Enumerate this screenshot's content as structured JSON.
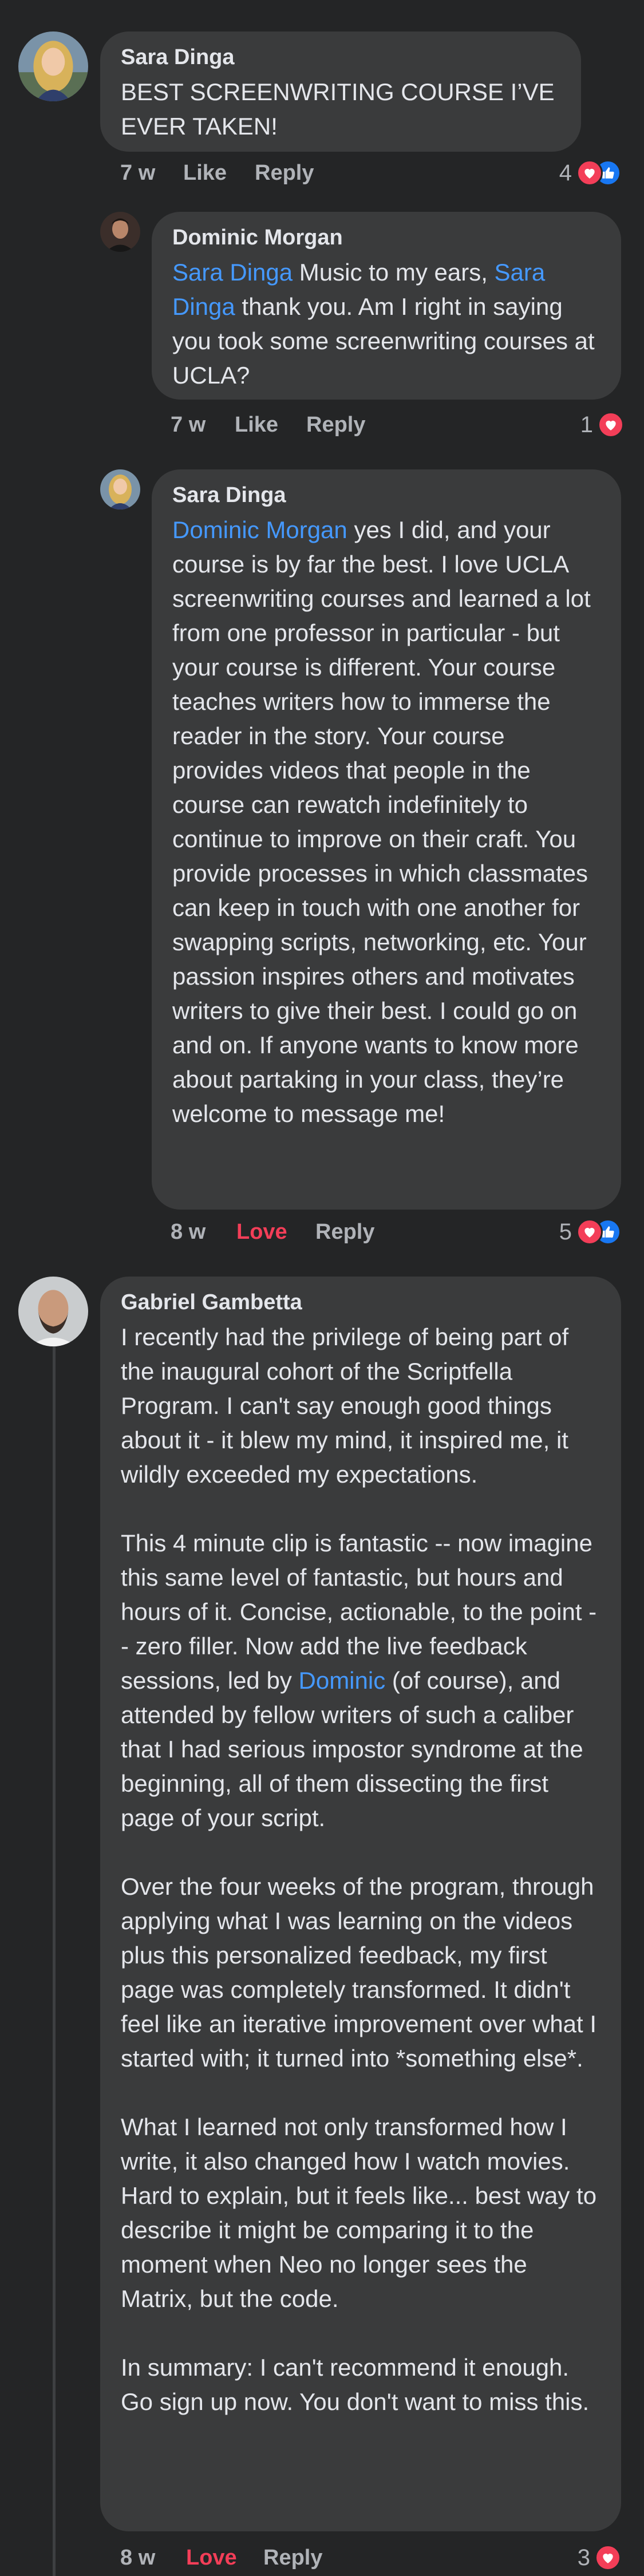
{
  "comments": [
    {
      "author": "Sara Dinga",
      "text": "BEST SCREENWRITING COURSE I’VE EVER TAKEN!",
      "time": "7 w",
      "like_label": "Like",
      "reply_label": "Reply",
      "reaction_count": "4",
      "reactions": [
        "heart-icon",
        "like-icon"
      ]
    },
    {
      "author": "Dominic Morgan",
      "mention1": "Sara Dinga",
      "text_a": " Music to my ears, ",
      "mention2": "Sara Dinga",
      "text_b": " thank you. Am I right in saying you took some screenwriting courses at UCLA?",
      "time": "7 w",
      "like_label": "Like",
      "reply_label": "Reply",
      "reaction_count": "1",
      "reactions": [
        "heart-icon"
      ]
    },
    {
      "author": "Sara Dinga",
      "mention": "Dominic Morgan",
      "text": " yes I did, and your course is by far the best. I love UCLA screenwriting courses and learned a lot from one professor in particular - but your course is different. Your course teaches writers how to immerse the reader in the story. Your course provides videos that people in the course can rewatch indefinitely to continue to improve on their craft. You provide processes in which classmates can keep in touch with one another for swapping scripts, networking, etc. Your passion inspires others and motivates writers to give their best. I could go on and on. If anyone wants to know more about partaking in your class, they’re welcome to message me!",
      "time": "8 w",
      "like_label": "Love",
      "reply_label": "Reply",
      "reaction_count": "5",
      "reactions": [
        "heart-icon",
        "like-icon"
      ]
    },
    {
      "author": "Gabriel Gambetta",
      "p1": "I recently had the privilege of being part of the inaugural cohort of the Scriptfella Program. I can't say enough good things about it - it blew my mind, it inspired me, it wildly exceeded my expectations.",
      "p2_a": "This 4 minute clip is fantastic -- now imagine this same level of fantastic, but hours and hours of it. Concise, actionable, to the point -- zero filler. Now add the live feedback sessions, led by ",
      "p2_mention": "Dominic",
      "p2_b": " (of course), and attended by fellow writers of such a caliber that I had serious impostor syndrome at the beginning, all of them dissecting the first page of your script.",
      "p3": "Over the four weeks of the program, through applying what I was learning on the videos plus this personalized feedback, my first page was completely transformed. It didn't feel like an iterative improvement over what I started with; it turned into *something else*.",
      "p4": "What I learned not only transformed how I write, it also changed how I watch movies. Hard to explain, but it feels like... best way to describe it might be comparing it to the moment when Neo no longer sees the Matrix, but the code.",
      "p5": "In summary: I can't recommend it enough. Go sign up now. You don't want to miss this.",
      "time": "8 w",
      "like_label": "Love",
      "reply_label": "Reply",
      "reaction_count": "3",
      "reactions": [
        "heart-icon"
      ]
    }
  ],
  "colors": {
    "background": "#242526",
    "bubble": "#3a3b3c",
    "mention": "#4599ff",
    "love": "#f33e58",
    "like": "#1877f2",
    "meta": "#b0b3b8"
  }
}
